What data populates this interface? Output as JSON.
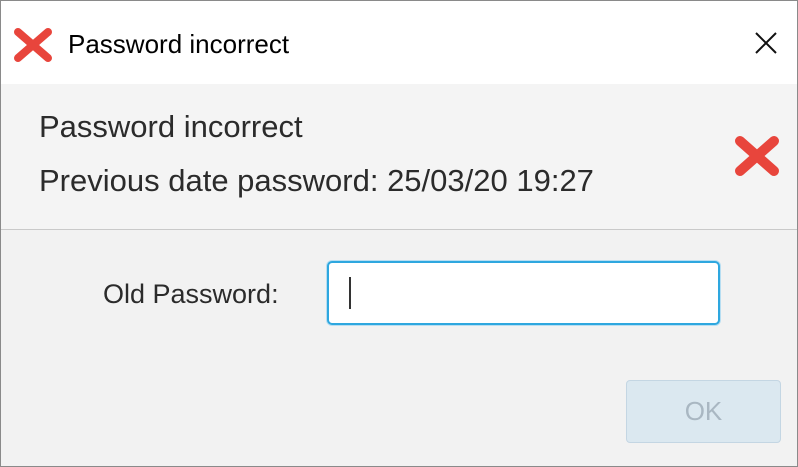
{
  "window": {
    "title": "Password incorrect",
    "title_icon": "red-x-icon",
    "close_icon": "close-icon"
  },
  "header": {
    "message": "Password incorrect",
    "detail": "Previous date password: 25/03/20 19:27",
    "icon": "red-x-icon"
  },
  "form": {
    "old_password_label": "Old Password:",
    "old_password_value": ""
  },
  "buttons": {
    "ok_label": "OK",
    "ok_enabled": false
  },
  "colors": {
    "error_red": "#e8453c",
    "focus_border": "#2ea7df",
    "disabled_button_bg": "#dbe8f0"
  }
}
